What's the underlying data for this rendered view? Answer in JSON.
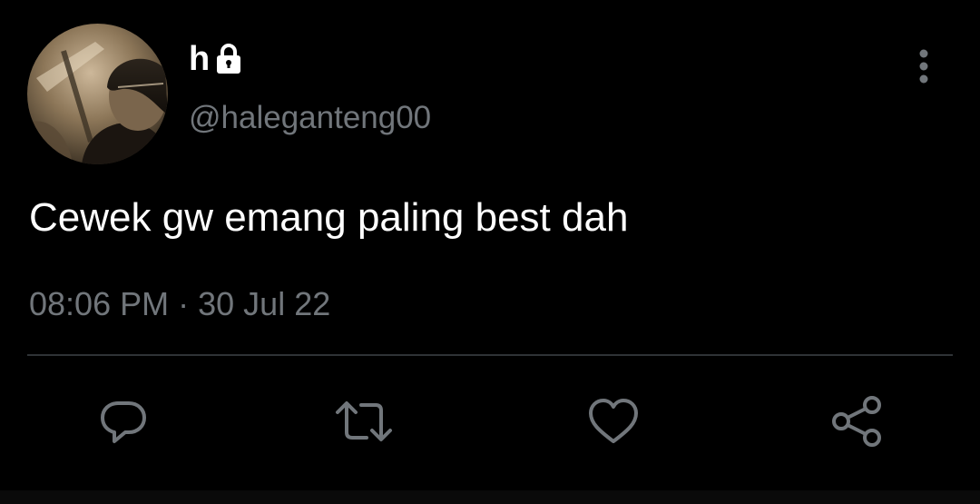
{
  "tweet": {
    "display_name": "h",
    "handle": "@haleganteng00",
    "text": "Cewek gw emang paling best dah",
    "time": "08:06 PM",
    "separator": "·",
    "date": "30 Jul 22"
  },
  "icons": {
    "lock": "lock-icon",
    "more": "more-vertical-icon",
    "reply": "reply-icon",
    "retweet": "retweet-icon",
    "like": "heart-icon",
    "share": "share-icon"
  },
  "colors": {
    "background": "#000000",
    "primary_text": "#ffffff",
    "secondary_text": "#71767b",
    "divider": "#2f3336"
  }
}
